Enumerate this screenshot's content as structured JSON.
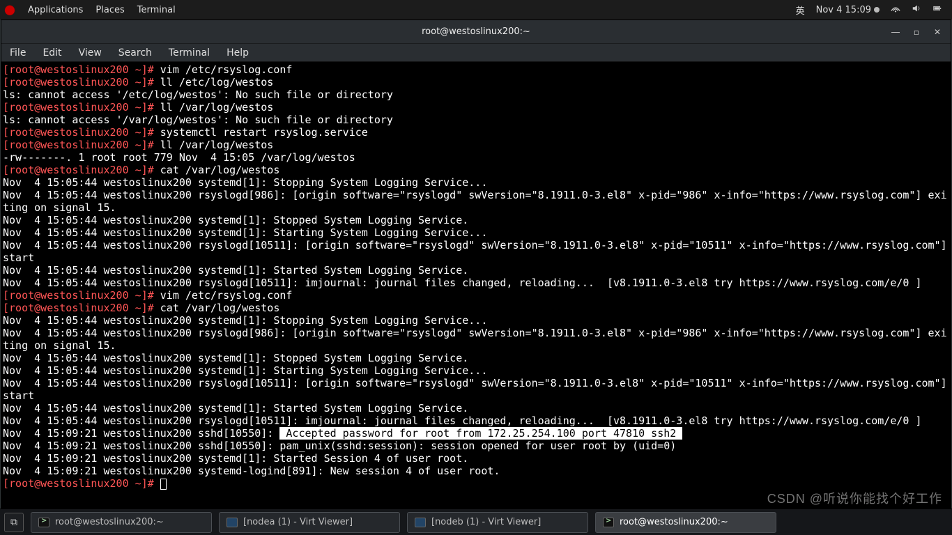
{
  "topbar": {
    "apps": "Applications",
    "places": "Places",
    "terminal": "Terminal",
    "ime": "英",
    "clock": "Nov 4  15:09"
  },
  "window": {
    "title": "root@westoslinux200:~",
    "menu": {
      "file": "File",
      "edit": "Edit",
      "view": "View",
      "search": "Search",
      "terminal": "Terminal",
      "help": "Help"
    }
  },
  "taskbar": {
    "t1": "root@westoslinux200:~",
    "t2": "[nodea (1) - Virt Viewer]",
    "t3": "[nodeb (1) - Virt Viewer]",
    "t4": "root@westoslinux200:~"
  },
  "watermark": "CSDN @听说你能找个好工作",
  "prompt": {
    "user_host": "root@westoslinux200",
    "cwd": "~",
    "sep_open": "[",
    "sep_close": "]# "
  },
  "lines": {
    "c1": "vim /etc/rsyslog.conf",
    "c2": "ll /etc/log/westos",
    "o1": "ls: cannot access '/etc/log/westos': No such file or directory",
    "c3": "ll /var/log/westos",
    "o2": "ls: cannot access '/var/log/westos': No such file or directory",
    "c4": "systemctl restart rsyslog.service",
    "c5": "ll /var/log/westos",
    "o3": "-rw-------. 1 root root 779 Nov  4 15:05 /var/log/westos",
    "c6": "cat /var/log/westos",
    "l1": "Nov  4 15:05:44 westoslinux200 systemd[1]: Stopping System Logging Service...",
    "l2": "Nov  4 15:05:44 westoslinux200 rsyslogd[986]: [origin software=\"rsyslogd\" swVersion=\"8.1911.0-3.el8\" x-pid=\"986\" x-info=\"https://www.rsyslog.com\"] exiting on signal 15.",
    "l3": "Nov  4 15:05:44 westoslinux200 systemd[1]: Stopped System Logging Service.",
    "l4": "Nov  4 15:05:44 westoslinux200 systemd[1]: Starting System Logging Service...",
    "l5": "Nov  4 15:05:44 westoslinux200 rsyslogd[10511]: [origin software=\"rsyslogd\" swVersion=\"8.1911.0-3.el8\" x-pid=\"10511\" x-info=\"https://www.rsyslog.com\"] start",
    "l6": "Nov  4 15:05:44 westoslinux200 systemd[1]: Started System Logging Service.",
    "l7": "Nov  4 15:05:44 westoslinux200 rsyslogd[10511]: imjournal: journal files changed, reloading...  [v8.1911.0-3.el8 try https://www.rsyslog.com/e/0 ]",
    "c7": "vim /etc/rsyslog.conf",
    "c8": "cat /var/log/westos",
    "l8": "Nov  4 15:05:44 westoslinux200 systemd[1]: Stopping System Logging Service...",
    "l9": "Nov  4 15:05:44 westoslinux200 rsyslogd[986]: [origin software=\"rsyslogd\" swVersion=\"8.1911.0-3.el8\" x-pid=\"986\" x-info=\"https://www.rsyslog.com\"] exiting on signal 15.",
    "l10": "Nov  4 15:05:44 westoslinux200 systemd[1]: Stopped System Logging Service.",
    "l11": "Nov  4 15:05:44 westoslinux200 systemd[1]: Starting System Logging Service...",
    "l12": "Nov  4 15:05:44 westoslinux200 rsyslogd[10511]: [origin software=\"rsyslogd\" swVersion=\"8.1911.0-3.el8\" x-pid=\"10511\" x-info=\"https://www.rsyslog.com\"] start",
    "l13": "Nov  4 15:05:44 westoslinux200 systemd[1]: Started System Logging Service.",
    "l14": "Nov  4 15:05:44 westoslinux200 rsyslogd[10511]: imjournal: journal files changed, reloading...  [v8.1911.0-3.el8 try https://www.rsyslog.com/e/0 ]",
    "l15a": "Nov  4 15:09:21 westoslinux200 sshd[10550]: ",
    "l15b": "Accepted password for root from 172.25.254.100 port 47810 ssh2",
    "l16": "Nov  4 15:09:21 westoslinux200 sshd[10550]: pam_unix(sshd:session): session opened for user root by (uid=0)",
    "l17": "Nov  4 15:09:21 westoslinux200 systemd[1]: Started Session 4 of user root.",
    "l18": "Nov  4 15:09:21 westoslinux200 systemd-logind[891]: New session 4 of user root."
  }
}
